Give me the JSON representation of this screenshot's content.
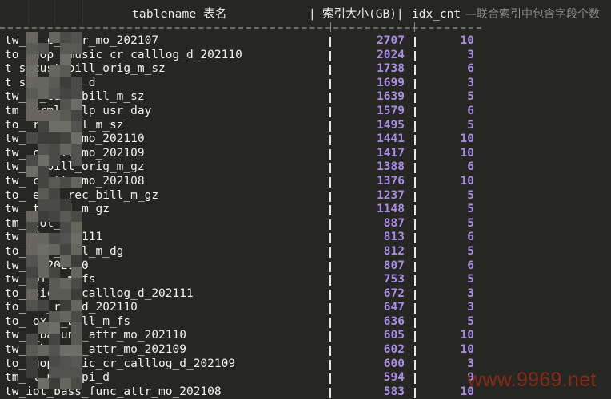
{
  "header": {
    "tablename_label": "tablename  表名",
    "pipe": "|",
    "size_label": "索引大小(GB)|",
    "cnt_label": "idx_cnt",
    "comment": "—联合索引中包含字段个数"
  },
  "rows": [
    {
      "name": "tw_     _     c_attr_mo_202107",
      "size": "2707",
      "cnt": "10"
    },
    {
      "name": "to_     gop_  music_cr_calllog_d_202110",
      "size": "2024",
      "cnt": "3"
    },
    {
      "name": "t       s_cust_bill_orig_m_sz",
      "size": "1738",
      "cnt": "6"
    },
    {
      "name": "t       s_v   f_fee_d",
      "size": "1699",
      "cnt": "3"
    },
    {
      "name": "tw_     s_cust_bill_m_sz",
      "size": "1639",
      "cnt": "5"
    },
    {
      "name": "tm_     trml  dvlp_usr_day",
      "size": "1579",
      "cnt": "6"
    },
    {
      "name": "to_           rec_bill_m_sz",
      "size": "1495",
      "cnt": "5"
    },
    {
      "name": "tw_           c_attr_mo_202110",
      "size": "1441",
      "cnt": "10"
    },
    {
      "name": "tw_           c_attr_mo_202109",
      "size": "1417",
      "cnt": "10"
    },
    {
      "name": "tw_           t_bill_orig_m_gz",
      "size": "1388",
      "cnt": "6"
    },
    {
      "name": "tw_           c_attr_mo_202108",
      "size": "1376",
      "cnt": "10"
    },
    {
      "name": "to_     ebox_rec_bill_m_gz",
      "size": "1237",
      "cnt": "5"
    },
    {
      "name": "tw_           t_bill_m_gz",
      "size": "1148",
      "cnt": "5"
    },
    {
      "name": "tm_           tot_day",
      "size": "887",
      "cnt": "5"
    },
    {
      "name": "tw_           day_202111",
      "size": "813",
      "cnt": "6"
    },
    {
      "name": "to_           rec_bill_m_dg",
      "size": "812",
      "cnt": "5"
    },
    {
      "name": "tw_            y_202110",
      "size": "807",
      "cnt": "6"
    },
    {
      "name": "tw_            bill_m_fs",
      "size": "753",
      "cnt": "5"
    },
    {
      "name": "to_            sic_cr_calllog_d_202111",
      "size": "672",
      "cnt": "3"
    },
    {
      "name": "to_           dr_rel_d_202110",
      "size": "647",
      "cnt": "3"
    },
    {
      "name": "to_     ox_   _bill_m_fs",
      "size": "636",
      "cnt": "5"
    },
    {
      "name": "tw_     _ba   unc_attr_mo_202110",
      "size": "605",
      "cnt": "10"
    },
    {
      "name": "tw_     _ba   unc_attr_mo_202109",
      "size": "602",
      "cnt": "10"
    },
    {
      "name": "to_     gop   music_cr_calllog_d_202109",
      "size": "600",
      "cnt": "3"
    },
    {
      "name": "tm_     l_n   r_kpi_d",
      "size": "594",
      "cnt": "9"
    },
    {
      "name": "tw_iot_bass_func_attr_mo_202108",
      "size": "583",
      "cnt": "10"
    }
  ],
  "watermark": "www.9969.net",
  "colors": {
    "background": "#262622",
    "text": "#f2f1ec",
    "number": "#a98ee6",
    "comment": "#8c8b86",
    "watermark": "#962d19"
  }
}
